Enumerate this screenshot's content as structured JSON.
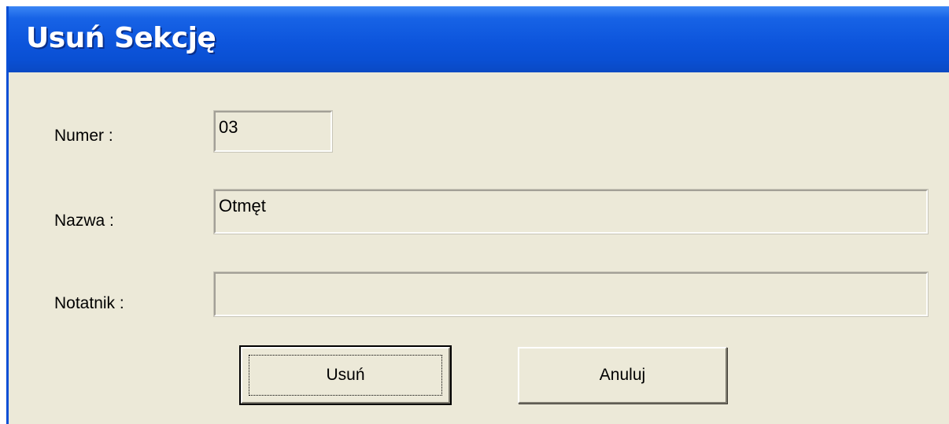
{
  "window": {
    "title": "Usuń Sekcję"
  },
  "form": {
    "numer": {
      "label": "Numer :",
      "value": "03"
    },
    "nazwa": {
      "label": "Nazwa :",
      "value": "Otmęt"
    },
    "notatnik": {
      "label": "Notatnik :",
      "value": ""
    }
  },
  "buttons": {
    "delete_label": "Usuń",
    "cancel_label": "Anuluj"
  },
  "colors": {
    "titlebar": "#0a50d4",
    "dialog_bg": "#ece9d8",
    "title_text": "#ffffff"
  }
}
